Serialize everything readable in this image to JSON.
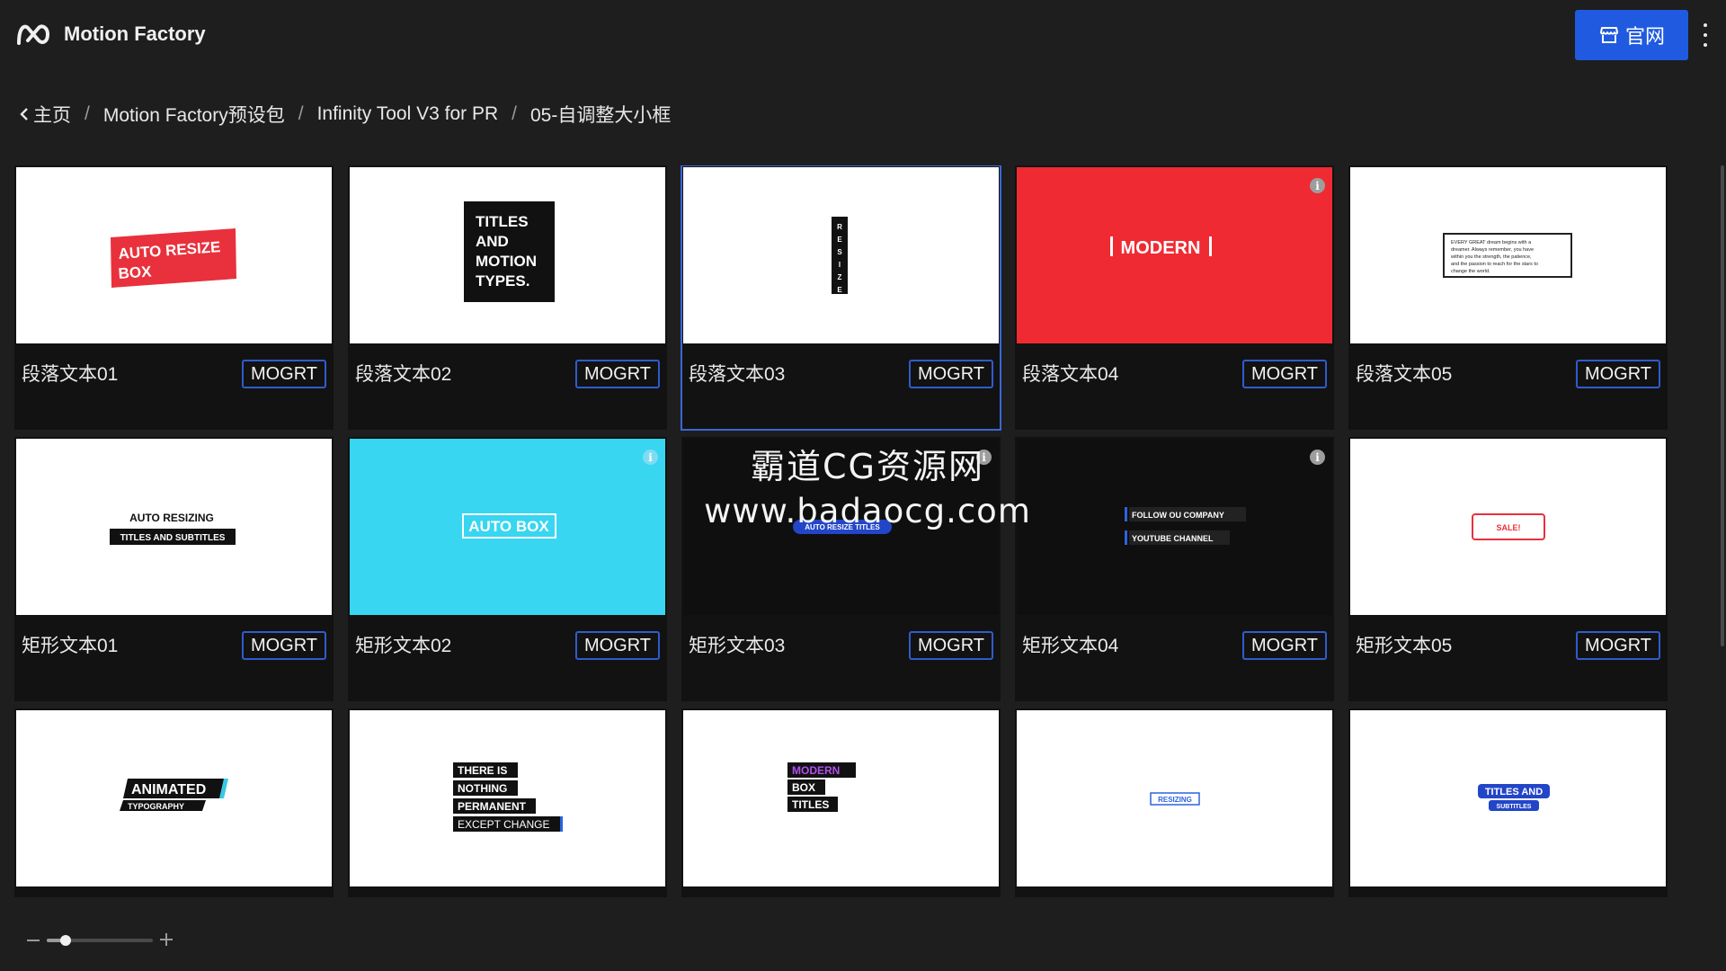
{
  "app": {
    "title": "Motion Factory",
    "logo_icon": "mf-logo-icon"
  },
  "header": {
    "site_button_label": "官网",
    "site_button_icon": "storefront-icon",
    "menu_icon": "kebab-menu-icon",
    "accent": "#1f5ae0"
  },
  "breadcrumb": [
    "主页",
    "Motion Factory预设包",
    "Infinity Tool V3 for PR",
    "05-自调整大小框"
  ],
  "cards": [
    {
      "title": "段落文本01",
      "button": "MOGRT",
      "thumb_text": [
        "AUTO RESIZE",
        "BOX"
      ]
    },
    {
      "title": "段落文本02",
      "button": "MOGRT",
      "thumb_text": [
        "TITLES",
        "AND",
        "MOTION",
        "TYPES."
      ]
    },
    {
      "title": "段落文本03",
      "button": "MOGRT",
      "thumb_text": [
        "R",
        "E",
        "S",
        "I",
        "Z",
        "E"
      ]
    },
    {
      "title": "段落文本04",
      "button": "MOGRT",
      "thumb_text": [
        "MODERN"
      ]
    },
    {
      "title": "段落文本05",
      "button": "MOGRT",
      "thumb_text": [
        "EVERY GREAT dream begins with a",
        "dreamer. Always remember, you have",
        "within you the strength, the patience,",
        "and the passion to reach for the stars to",
        "change the world."
      ]
    },
    {
      "title": "矩形文本01",
      "button": "MOGRT",
      "thumb_text": [
        "AUTO RESIZING",
        "TITLES AND SUBTITLES"
      ]
    },
    {
      "title": "矩形文本02",
      "button": "MOGRT",
      "thumb_text": [
        "AUTO BOX"
      ]
    },
    {
      "title": "矩形文本03",
      "button": "MOGRT",
      "thumb_text": [
        "AUTO RESIZE TITLES"
      ]
    },
    {
      "title": "矩形文本04",
      "button": "MOGRT",
      "thumb_text": [
        "FOLLOW OU COMPANY",
        "YOUTUBE CHANNEL"
      ]
    },
    {
      "title": "矩形文本05",
      "button": "MOGRT",
      "thumb_text": [
        "SALE!"
      ]
    },
    {
      "title": "",
      "button": "",
      "thumb_text": [
        "ANIMATED",
        "TYPOGRAPHY"
      ]
    },
    {
      "title": "",
      "button": "",
      "thumb_text": [
        "THERE IS",
        "NOTHING",
        "PERMANENT",
        "EXCEPT CHANGE"
      ]
    },
    {
      "title": "",
      "button": "",
      "thumb_text": [
        "MODERN",
        "BOX",
        "TITLES"
      ]
    },
    {
      "title": "",
      "button": "",
      "thumb_text": [
        "RESIZING"
      ]
    },
    {
      "title": "",
      "button": "",
      "thumb_text": [
        "TITLES AND",
        "SUBTITLES"
      ]
    }
  ],
  "watermark": {
    "line1": "霸道CG资源网",
    "line2": "www.badaocg.com"
  },
  "zoom": {
    "level": 0.18
  }
}
